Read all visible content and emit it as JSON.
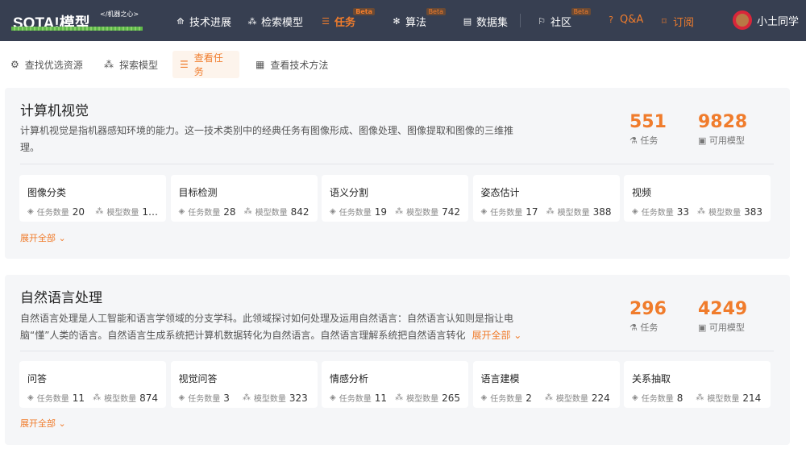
{
  "nav": {
    "logo": "SOTA!模型",
    "logo_sub": "</机器之心>",
    "items": [
      {
        "label": "技术进展",
        "icon": "cloud-up-icon"
      },
      {
        "label": "检索模型",
        "icon": "circles-icon"
      },
      {
        "label": "任务",
        "icon": "layers-icon",
        "beta": "Beta"
      },
      {
        "label": "算法",
        "icon": "atom-icon",
        "beta": "Beta"
      },
      {
        "label": "数据集",
        "icon": "database-icon"
      },
      {
        "label": "社区",
        "icon": "flag-icon",
        "beta": "Beta"
      },
      {
        "label": "Q&A",
        "icon": "question-icon"
      },
      {
        "label": "订阅",
        "icon": "bookmark-icon"
      }
    ],
    "user": "小土同学"
  },
  "subnav": [
    "查找优选资源",
    "探索模型",
    "查看任务",
    "查看技术方法"
  ],
  "sections": [
    {
      "title": "计算机视觉",
      "desc": "计算机视觉是指机器感知环境的能力。这一技术类别中的经典任务有图像形成、图像处理、图像提取和图像的三维推理。",
      "tasks": "551",
      "tasks_label": "任务",
      "models": "9828",
      "models_label": "可用模型",
      "tiles": [
        {
          "name": "图像分类",
          "t": "20",
          "m": "1…"
        },
        {
          "name": "目标检测",
          "t": "28",
          "m": "842"
        },
        {
          "name": "语义分割",
          "t": "19",
          "m": "742"
        },
        {
          "name": "姿态估计",
          "t": "17",
          "m": "388"
        },
        {
          "name": "视频",
          "t": "33",
          "m": "383"
        }
      ],
      "expand": "展开全部"
    },
    {
      "title": "自然语言处理",
      "desc": "自然语言处理是人工智能和语言学领域的分支学科。此领域探讨如何处理及运用自然语言：自然语言认知则是指让电脑“懂”人类的语言。自然语言生成系统把计算机数据转化为自然语言。自然语言理解系统把自然语言转化",
      "desc_expand": "展开全部",
      "tasks": "296",
      "tasks_label": "任务",
      "models": "4249",
      "models_label": "可用模型",
      "tiles": [
        {
          "name": "问答",
          "t": "11",
          "m": "874"
        },
        {
          "name": "视觉问答",
          "t": "3",
          "m": "323"
        },
        {
          "name": "情感分析",
          "t": "11",
          "m": "265"
        },
        {
          "name": "语言建模",
          "t": "2",
          "m": "224"
        },
        {
          "name": "关系抽取",
          "t": "8",
          "m": "214"
        }
      ],
      "expand": "展开全部"
    }
  ],
  "labels": {
    "task_count": "任务数量",
    "model_count": "模型数量"
  }
}
